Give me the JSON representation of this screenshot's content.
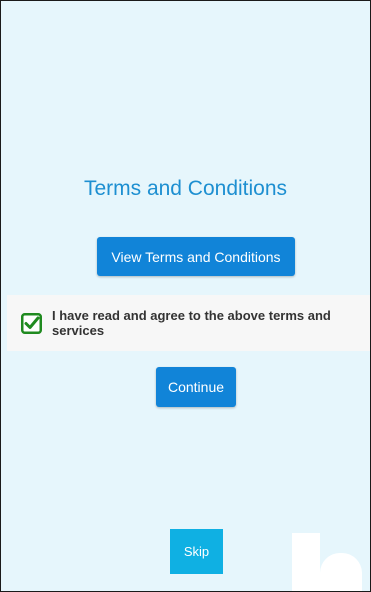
{
  "terms": {
    "title": "Terms and Conditions",
    "view_button_label": "View Terms and Conditions",
    "agree_label": "I have read and agree to the above terms and services",
    "agree_checked": true,
    "continue_label": "Continue",
    "skip_label": "Skip"
  },
  "icons": {
    "checkbox": "checkbox-checked-icon"
  },
  "colors": {
    "background": "#e6f6fc",
    "title": "#1d8fd1",
    "primary_button": "#1184d8",
    "skip_button": "#0fb0e3",
    "checkbox": "#1f8a1f"
  }
}
